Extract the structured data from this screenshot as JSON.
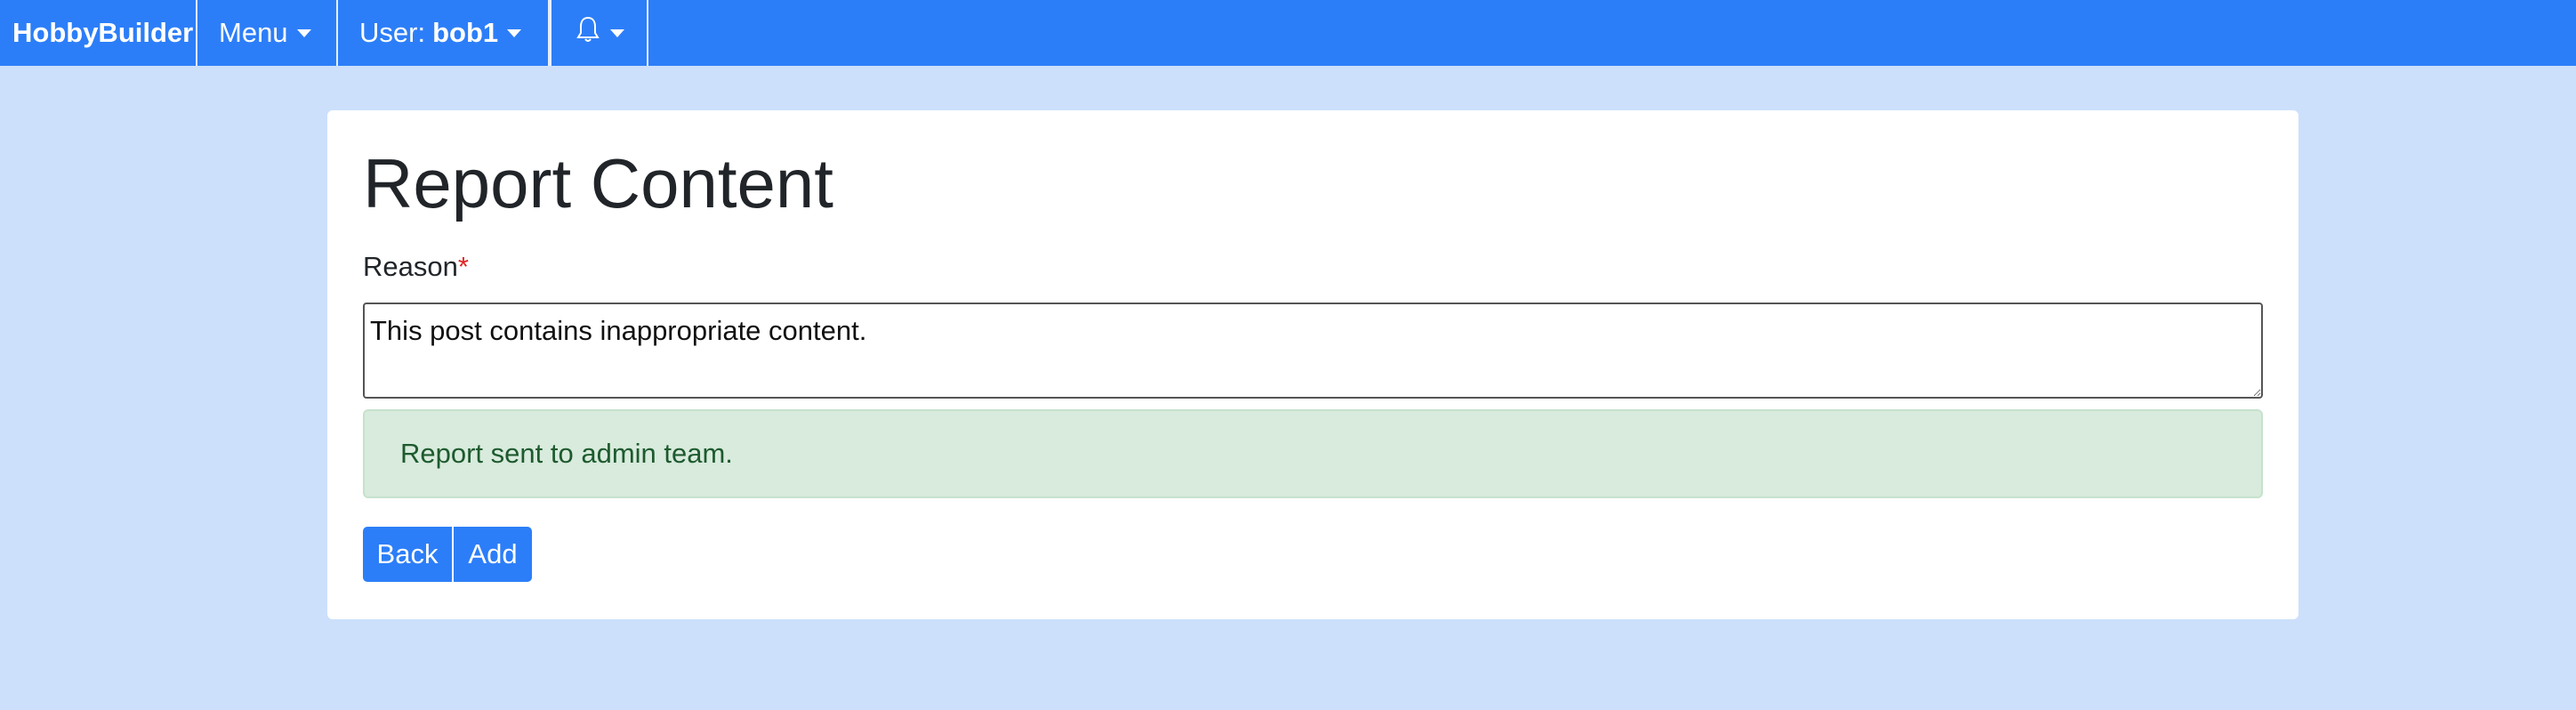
{
  "navbar": {
    "brand": "HobbyBuilder",
    "menu_label": "Menu",
    "user_prefix": "User:",
    "user_name": "bob1",
    "bell_icon": "bell-icon"
  },
  "form": {
    "title": "Report Content",
    "reason_label": "Reason",
    "required_marker": "*",
    "reason_value": "This post contains inappropriate content.",
    "alert_text": "Report sent to admin team.",
    "back_label": "Back",
    "add_label": "Add"
  },
  "colors": {
    "navbar": "#2c7ef8",
    "page_background": "#cce0fb",
    "alert_background": "#d8ebdd",
    "alert_text": "#1e5a2e",
    "required": "#e02424"
  }
}
